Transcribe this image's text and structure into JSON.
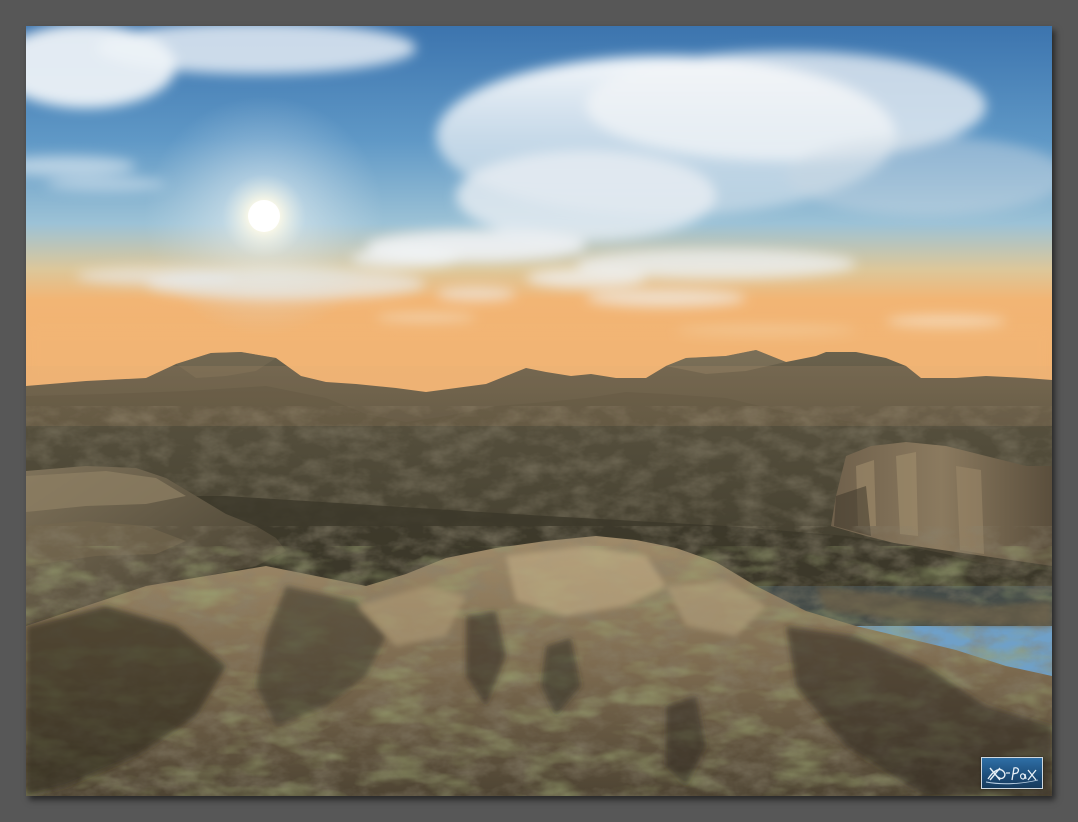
{
  "scene": {
    "subject": "mountain-landscape",
    "colors": {
      "sky_top": "#3f79b3",
      "sky_mid": "#6ea6ce",
      "horizon_glow": "#f2b870",
      "haze": "#e8c89a",
      "sun": "#fffbe8",
      "far_ridge": "#5e5746",
      "mid_ridge": "#4d4a3a",
      "near_rock": "#8c7a5e",
      "moss": "#5f6a34",
      "shadow": "#2e2a20",
      "frame": "#575757"
    }
  },
  "signature": {
    "text": "X-PaX",
    "kind": "handwritten-logo"
  }
}
